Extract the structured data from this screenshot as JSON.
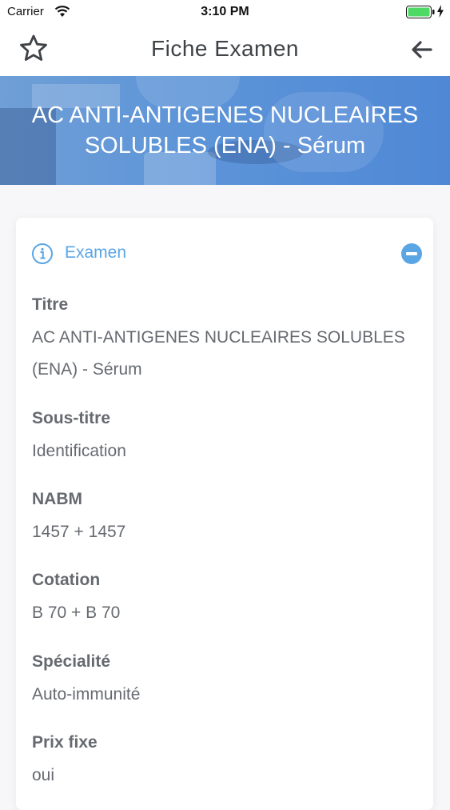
{
  "status_bar": {
    "carrier": "Carrier",
    "time": "3:10 PM"
  },
  "nav": {
    "title": "Fiche Examen",
    "favorite_icon": "star-outline-icon",
    "back_icon": "arrow-left-icon"
  },
  "banner": {
    "title": "AC ANTI-ANTIGENES NUCLEAIRES SOLUBLES (ENA) - Sérum"
  },
  "section": {
    "label": "Examen",
    "accent": "#5aa6e4"
  },
  "fields": [
    {
      "label": "Titre",
      "value": "AC ANTI-ANTIGENES NUCLEAIRES SOLUBLES (ENA) - Sérum"
    },
    {
      "label": "Sous-titre",
      "value": "Identification"
    },
    {
      "label": "NABM",
      "value": "1457 + 1457"
    },
    {
      "label": "Cotation",
      "value": "B 70 + B 70"
    },
    {
      "label": "Spécialité",
      "value": "Auto-immunité"
    },
    {
      "label": "Prix fixe",
      "value": "oui"
    }
  ]
}
